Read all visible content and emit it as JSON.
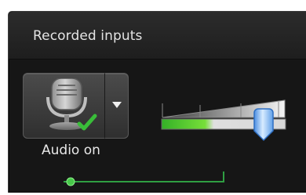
{
  "panel": {
    "title": "Recorded inputs"
  },
  "audio": {
    "label": "Audio on",
    "enabled": true,
    "button_icon": "microphone-icon",
    "status_icon": "checkmark-icon",
    "menu_icon": "chevron-down-icon"
  },
  "volume": {
    "level_fraction": 0.9,
    "input_level_fraction": 0.42,
    "meter_color": "#53d32e"
  },
  "timeline": {
    "track_color": "#2f9f42",
    "dot_color": "#48c94a"
  }
}
